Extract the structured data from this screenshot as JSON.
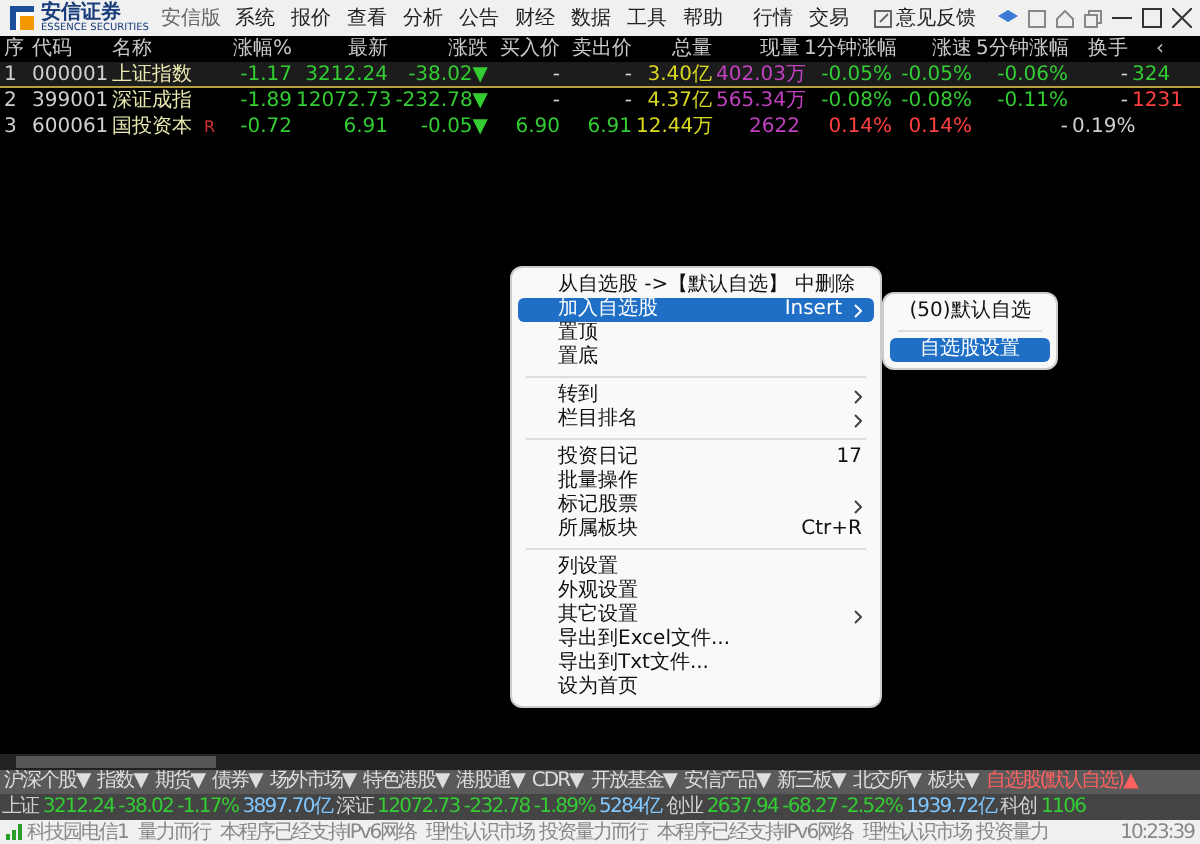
{
  "title_bar": {
    "brand": "安信证券",
    "brand_sub": "ESSENCE SECURITIES",
    "edition": "安信版",
    "menu": [
      "系统",
      "报价",
      "查看",
      "分析",
      "公告",
      "财经",
      "数据",
      "工具",
      "帮助"
    ],
    "right_menu": [
      "行情",
      "交易"
    ],
    "feedback": "意见反馈"
  },
  "table": {
    "columns": [
      "序",
      "代码",
      "名称",
      "涨幅%",
      "最新",
      "涨跌",
      "买入价",
      "卖出价",
      "总量",
      "现量",
      "1分钟涨幅",
      "涨速",
      "5分钟涨幅",
      "换手",
      "‹"
    ],
    "rows": [
      {
        "selected": true,
        "flag": "",
        "cells": [
          {
            "text": "1",
            "color": "#d0d0d0"
          },
          {
            "text": "000001",
            "color": "#d0d0d0"
          },
          {
            "text": "上证指数",
            "color": "#e8e8b0"
          },
          {
            "text": "-1.17",
            "color": "#33cc33"
          },
          {
            "text": "3212.24",
            "color": "#33cc33"
          },
          {
            "text": "-38.02▼",
            "color": "#33cc33"
          },
          {
            "text": "-",
            "color": "#d0d0d0"
          },
          {
            "text": "-",
            "color": "#d0d0d0"
          },
          {
            "text": "3.40亿",
            "color": "#d8d820"
          },
          {
            "text": "402.03万",
            "color": "#c040c0"
          },
          {
            "text": "-0.05%",
            "color": "#33cc33"
          },
          {
            "text": "-0.05%",
            "color": "#33cc33"
          },
          {
            "text": "-0.06%",
            "color": "#33cc33"
          },
          {
            "text": "-",
            "color": "#d0d0d0"
          },
          {
            "text": "324",
            "color": "#33cc33"
          }
        ]
      },
      {
        "selected": false,
        "flag": "",
        "cells": [
          {
            "text": "2",
            "color": "#d0d0d0"
          },
          {
            "text": "399001",
            "color": "#d0d0d0"
          },
          {
            "text": "深证成指",
            "color": "#e8e8b0"
          },
          {
            "text": "-1.89",
            "color": "#33cc33"
          },
          {
            "text": "12072.73",
            "color": "#33cc33"
          },
          {
            "text": "-232.78▼",
            "color": "#33cc33"
          },
          {
            "text": "-",
            "color": "#d0d0d0"
          },
          {
            "text": "-",
            "color": "#d0d0d0"
          },
          {
            "text": "4.37亿",
            "color": "#d8d820"
          },
          {
            "text": "565.34万",
            "color": "#c040c0"
          },
          {
            "text": "-0.08%",
            "color": "#33cc33"
          },
          {
            "text": "-0.08%",
            "color": "#33cc33"
          },
          {
            "text": "-0.11%",
            "color": "#33cc33"
          },
          {
            "text": "-",
            "color": "#d0d0d0"
          },
          {
            "text": "1231",
            "color": "#ff4040"
          }
        ]
      },
      {
        "selected": false,
        "flag": "R",
        "cells": [
          {
            "text": "3",
            "color": "#d0d0d0"
          },
          {
            "text": "600061",
            "color": "#d0d0d0"
          },
          {
            "text": "国投资本",
            "color": "#e8e8b0"
          },
          {
            "text": "-0.72",
            "color": "#33cc33"
          },
          {
            "text": "6.91",
            "color": "#33cc33"
          },
          {
            "text": "-0.05▼",
            "color": "#33cc33"
          },
          {
            "text": "6.90",
            "color": "#33cc33"
          },
          {
            "text": "6.91",
            "color": "#33cc33"
          },
          {
            "text": "12.44万",
            "color": "#d8d820"
          },
          {
            "text": "2622",
            "color": "#c040c0"
          },
          {
            "text": "0.14%",
            "color": "#ff4040"
          },
          {
            "text": "0.14%",
            "color": "#ff4040"
          },
          {
            "text": "-",
            "color": "#d0d0d0"
          },
          {
            "text": "0.19%",
            "color": "#d0d0d0"
          }
        ]
      }
    ]
  },
  "context_menu": {
    "items": [
      {
        "kind": "item",
        "label": "从自选股 ->【默认自选】 中删除",
        "submenu": false,
        "selected": false
      },
      {
        "kind": "item",
        "label": "加入自选股",
        "shortcut": "Insert",
        "submenu": true,
        "selected": true
      },
      {
        "kind": "item",
        "label": "置顶",
        "submenu": false,
        "selected": false
      },
      {
        "kind": "item",
        "label": "置底",
        "submenu": false,
        "selected": false
      },
      {
        "kind": "separator"
      },
      {
        "kind": "item",
        "label": "转到",
        "submenu": true,
        "selected": false
      },
      {
        "kind": "item",
        "label": "栏目排名",
        "submenu": true,
        "selected": false
      },
      {
        "kind": "separator"
      },
      {
        "kind": "item",
        "label": "投资日记",
        "shortcut": "17",
        "submenu": false,
        "selected": false
      },
      {
        "kind": "item",
        "label": "批量操作",
        "submenu": false,
        "selected": false
      },
      {
        "kind": "item",
        "label": "标记股票",
        "submenu": true,
        "selected": false
      },
      {
        "kind": "item",
        "label": "所属板块",
        "shortcut": "Ctr+R",
        "submenu": false,
        "selected": false
      },
      {
        "kind": "separator"
      },
      {
        "kind": "item",
        "label": "列设置",
        "submenu": false,
        "selected": false
      },
      {
        "kind": "item",
        "label": "外观设置",
        "submenu": false,
        "selected": false
      },
      {
        "kind": "item",
        "label": "其它设置",
        "submenu": true,
        "selected": false
      },
      {
        "kind": "item",
        "label": "导出到Excel文件...",
        "submenu": false,
        "selected": false
      },
      {
        "kind": "item",
        "label": "导出到Txt文件...",
        "submenu": false,
        "selected": false
      },
      {
        "kind": "item",
        "label": "设为首页",
        "submenu": false,
        "selected": false
      }
    ]
  },
  "submenu": {
    "items": [
      {
        "kind": "item",
        "label": "(50)默认自选",
        "selected": false
      },
      {
        "kind": "separator"
      },
      {
        "kind": "item",
        "label": "自选股设置",
        "selected": true
      }
    ]
  },
  "bottom_tabs": [
    {
      "label": "沪深个股▼",
      "selected": false
    },
    {
      "label": "指数▼",
      "selected": false
    },
    {
      "label": "期货▼",
      "selected": false
    },
    {
      "label": "债券▼",
      "selected": false
    },
    {
      "label": "场外市场▼",
      "selected": false
    },
    {
      "label": "特色港股▼",
      "selected": false
    },
    {
      "label": "港股通▼",
      "selected": false
    },
    {
      "label": "CDR▼",
      "selected": false
    },
    {
      "label": "开放基金▼",
      "selected": false
    },
    {
      "label": "安信产品▼",
      "selected": false
    },
    {
      "label": "新三板▼",
      "selected": false
    },
    {
      "label": "北交所▼",
      "selected": false
    },
    {
      "label": "板块▼",
      "selected": false
    },
    {
      "label": "自选股(默认自选)▲",
      "selected": true
    }
  ],
  "ticker": [
    {
      "text": "上证",
      "color": "#d0d0d0"
    },
    {
      "text": "3212.24",
      "color": "#33cc33"
    },
    {
      "text": "-38.02",
      "color": "#33cc33"
    },
    {
      "text": "-1.17%",
      "color": "#33cc33"
    },
    {
      "text": "3897.70亿",
      "color": "#80c8ff"
    },
    {
      "text": "深证",
      "color": "#d0d0d0"
    },
    {
      "text": "12072.73",
      "color": "#33cc33"
    },
    {
      "text": "-232.78",
      "color": "#33cc33"
    },
    {
      "text": "-1.89%",
      "color": "#33cc33"
    },
    {
      "text": "5284亿",
      "color": "#80c8ff"
    },
    {
      "text": "创业",
      "color": "#d0d0d0"
    },
    {
      "text": "2637.94",
      "color": "#33cc33"
    },
    {
      "text": "-68.27",
      "color": "#33cc33"
    },
    {
      "text": "-2.52%",
      "color": "#33cc33"
    },
    {
      "text": "1939.72亿",
      "color": "#80c8ff"
    },
    {
      "text": "科创",
      "color": "#d0d0d0"
    },
    {
      "text": "1106",
      "color": "#33cc33"
    }
  ],
  "status_bar": {
    "server": "科技园电信1",
    "messages": [
      "量力而行",
      "本程序已经支持IPv6网络",
      "理性认识市场 投资量力而行",
      "本程序已经支持IPv6网络",
      "理性认识市场 投资量力"
    ],
    "time": "10:23:39"
  }
}
